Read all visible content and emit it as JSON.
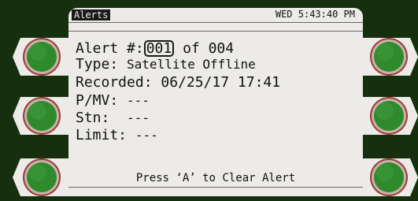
{
  "status_bar": {
    "tab": "Alerts",
    "datetime": "WED 5:43:40 PM"
  },
  "alert": {
    "number_label": "Alert #:",
    "index": "001",
    "of_label": "of",
    "total": "004",
    "type_label": "Type:",
    "type_value": "Satellite Offline",
    "recorded_label": "Recorded:",
    "recorded_value": "06/25/17 17:41",
    "pmv_label": "P/MV:",
    "pmv_value": "---",
    "stn_label": "Stn:",
    "stn_value": "---",
    "limit_label": "Limit:",
    "limit_value": "---"
  },
  "prompt": "Press ‘A’ to Clear Alert",
  "colors": {
    "background": "#162f0e",
    "screen": "#ecebe7",
    "softkey": "#2f8a2c",
    "softkey_ring": "#c8b2ac"
  }
}
